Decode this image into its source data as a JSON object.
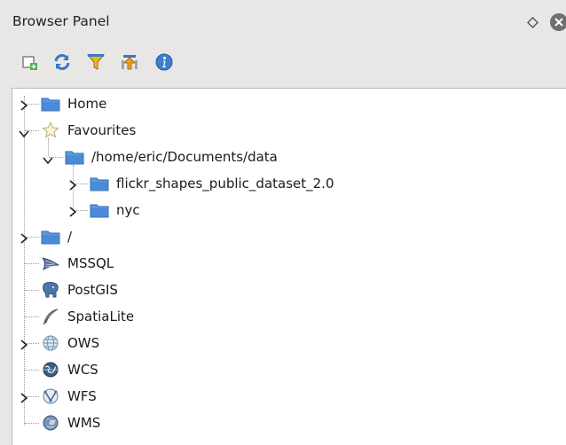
{
  "panel": {
    "title": "Browser Panel"
  },
  "toolbar": {
    "add_selected_layers": "add-layer-icon",
    "refresh": "refresh-icon",
    "filter": "filter-icon",
    "collapse_all": "collapse-all-icon",
    "properties": "info-icon"
  },
  "tree": {
    "home": "Home",
    "favourites": "Favourites",
    "fav_path": "/home/eric/Documents/data",
    "flickr": "flickr_shapes_public_dataset_2.0",
    "nyc": "nyc",
    "root": "/",
    "mssql": "MSSQL",
    "postgis": "PostGIS",
    "spatialite": "SpatiaLite",
    "ows": "OWS",
    "wcs": "WCS",
    "wfs": "WFS",
    "wms": "WMS"
  },
  "colors": {
    "folder_blue": "#3b7fcf",
    "panel_bg": "#e8e7e6",
    "tree_bg": "#ffffff"
  }
}
